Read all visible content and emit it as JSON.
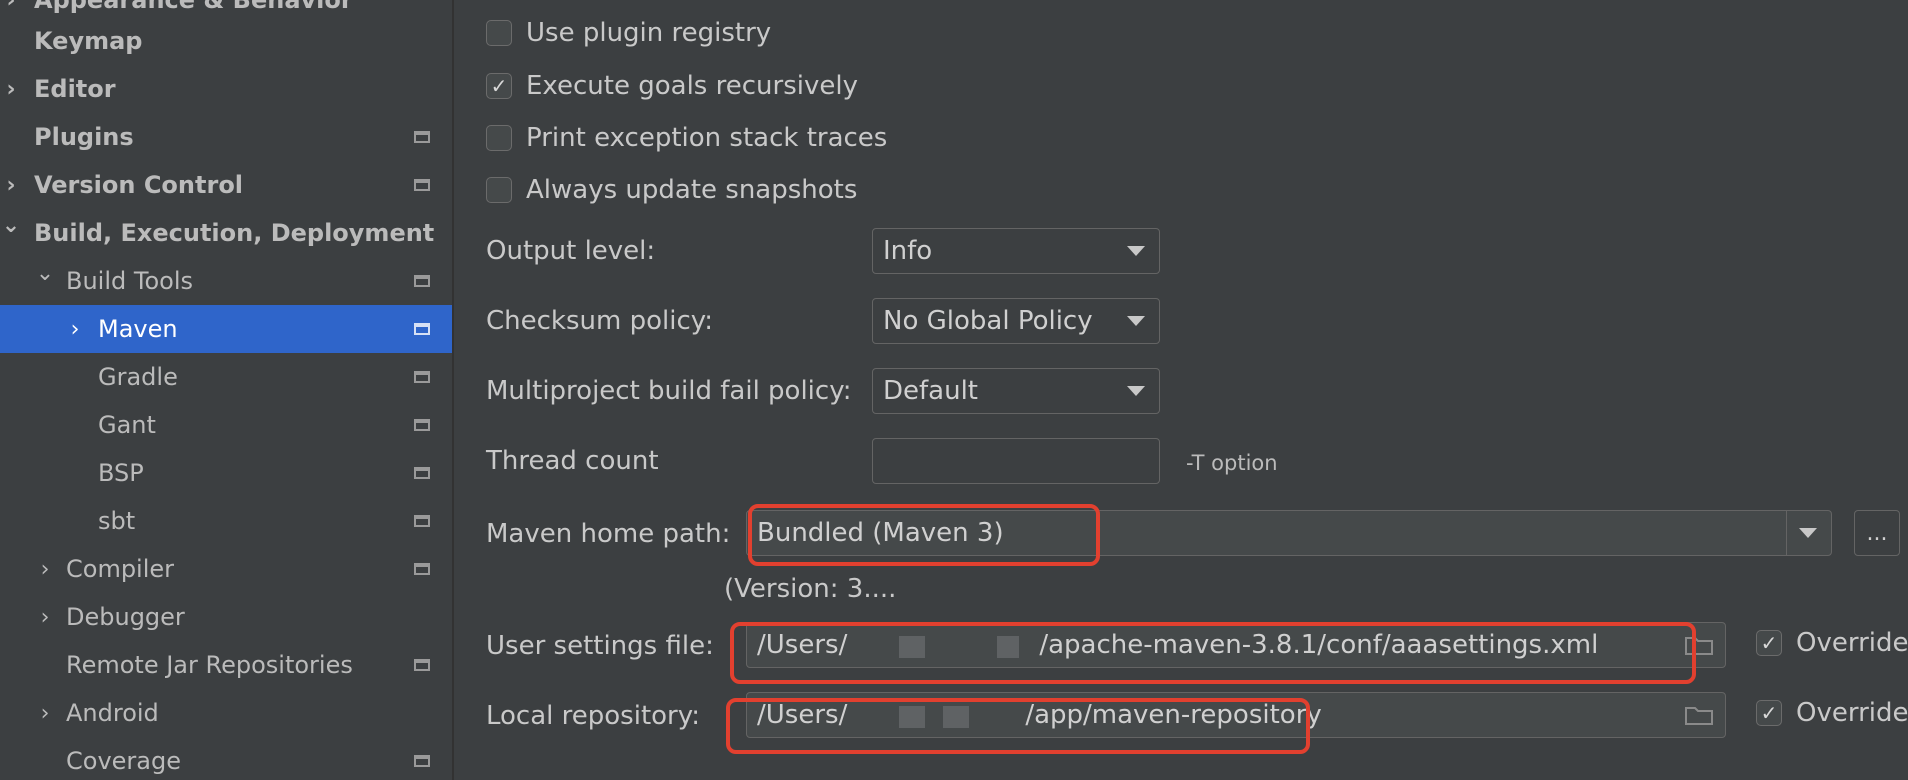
{
  "sidebar": {
    "items": [
      {
        "label": "Appearance & Behavior",
        "arrow": "›",
        "bold": true
      },
      {
        "label": "Keymap",
        "arrow": "",
        "bold": true
      },
      {
        "label": "Editor",
        "arrow": "›",
        "bold": true
      },
      {
        "label": "Plugins",
        "arrow": "",
        "bold": true
      },
      {
        "label": "Version Control",
        "arrow": "›",
        "bold": true
      },
      {
        "label": "Build, Execution, Deployment",
        "arrow": "⌄",
        "bold": true
      },
      {
        "label": "Build Tools",
        "arrow": "⌄",
        "bold": false
      },
      {
        "label": "Maven",
        "arrow": "›",
        "bold": false
      },
      {
        "label": "Gradle",
        "arrow": "",
        "bold": false
      },
      {
        "label": "Gant",
        "arrow": "",
        "bold": false
      },
      {
        "label": "BSP",
        "arrow": "",
        "bold": false
      },
      {
        "label": "sbt",
        "arrow": "",
        "bold": false
      },
      {
        "label": "Compiler",
        "arrow": "›",
        "bold": false
      },
      {
        "label": "Debugger",
        "arrow": "›",
        "bold": false
      },
      {
        "label": "Remote Jar Repositories",
        "arrow": "",
        "bold": false
      },
      {
        "label": "Android",
        "arrow": "›",
        "bold": false
      },
      {
        "label": "Coverage",
        "arrow": "",
        "bold": false
      }
    ]
  },
  "settings": {
    "checkboxes": [
      {
        "label": "Use plugin registry",
        "checked": false
      },
      {
        "label": "Execute goals recursively",
        "checked": true
      },
      {
        "label": "Print exception stack traces",
        "checked": false
      },
      {
        "label": "Always update snapshots",
        "checked": false
      }
    ],
    "output_level": {
      "label": "Output level:",
      "value": "Info"
    },
    "checksum_policy": {
      "label": "Checksum policy:",
      "value": "No Global Policy"
    },
    "fail_policy": {
      "label": "Multiproject build fail policy:",
      "value": "Default"
    },
    "thread_count": {
      "label": "Thread count",
      "value": "",
      "hint": "-T option"
    },
    "maven_home": {
      "label": "Maven home path:",
      "value": "Bundled (Maven 3)",
      "browse": "...",
      "version": "(Version: 3...."
    },
    "user_settings": {
      "label": "User settings file:",
      "value_prefix": "/Users/",
      "value_suffix": "/apache-maven-3.8.1/conf/aaasettings.xml",
      "override_label": "Override",
      "override_checked": true
    },
    "local_repo": {
      "label": "Local repository:",
      "value_prefix": "/Users/",
      "value_suffix": "/app/maven-repository",
      "override_label": "Override",
      "override_checked": true
    }
  },
  "colors": {
    "accent": "#2f65ca",
    "highlight": "#e2402f"
  }
}
